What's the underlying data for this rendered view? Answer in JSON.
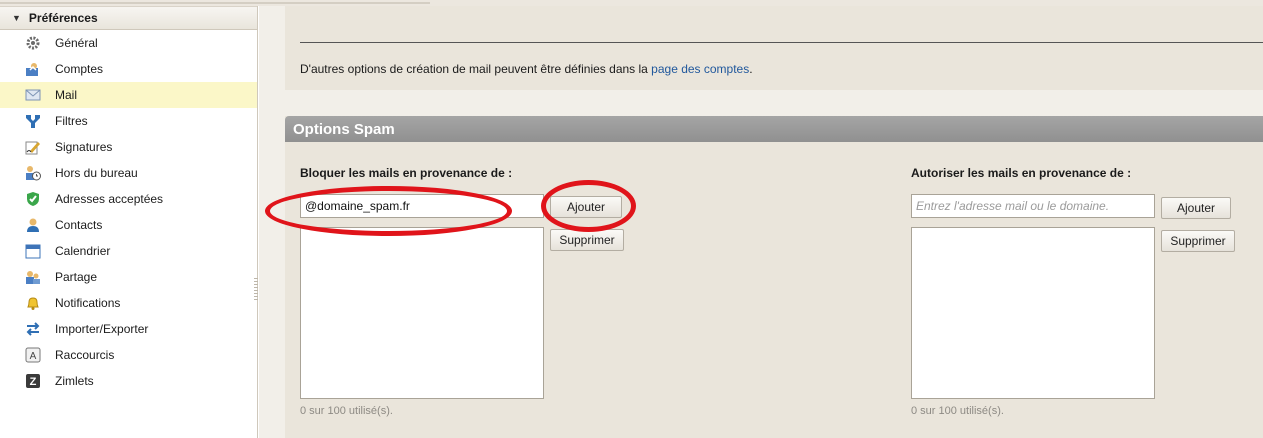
{
  "sidebar": {
    "header": "Préférences",
    "items": [
      {
        "label": "Général",
        "icon": "gear-icon",
        "selected": false
      },
      {
        "label": "Comptes",
        "icon": "accounts-icon",
        "selected": false
      },
      {
        "label": "Mail",
        "icon": "mail-icon",
        "selected": true
      },
      {
        "label": "Filtres",
        "icon": "filter-icon",
        "selected": false
      },
      {
        "label": "Signatures",
        "icon": "signature-icon",
        "selected": false
      },
      {
        "label": "Hors du bureau",
        "icon": "out-of-office-icon",
        "selected": false
      },
      {
        "label": "Adresses acceptées",
        "icon": "shield-check-icon",
        "selected": false
      },
      {
        "label": "Contacts",
        "icon": "contact-icon",
        "selected": false
      },
      {
        "label": "Calendrier",
        "icon": "calendar-icon",
        "selected": false
      },
      {
        "label": "Partage",
        "icon": "sharing-icon",
        "selected": false
      },
      {
        "label": "Notifications",
        "icon": "bell-icon",
        "selected": false
      },
      {
        "label": "Importer/Exporter",
        "icon": "import-export-icon",
        "selected": false
      },
      {
        "label": "Raccourcis",
        "icon": "shortcut-icon",
        "selected": false
      },
      {
        "label": "Zimlets",
        "icon": "zimlet-icon",
        "selected": false
      }
    ]
  },
  "main": {
    "info_text": "D'autres options de création de mail peuvent être définies dans la ",
    "info_link": "page des comptes",
    "info_suffix": ".",
    "spam": {
      "title": "Options Spam",
      "block": {
        "label": "Bloquer les mails en provenance de :",
        "input_value": "@domaine_spam.fr",
        "add_label": "Ajouter",
        "remove_label": "Supprimer",
        "usage": "0 sur 100 utilisé(s)."
      },
      "allow": {
        "label": "Autoriser les mails en provenance de :",
        "input_placeholder": "Entrez l'adresse mail ou le domaine.",
        "add_label": "Ajouter",
        "remove_label": "Supprimer",
        "usage": "0 sur 100 utilisé(s)."
      }
    }
  },
  "colors": {
    "annotation_ring": "#e0141a",
    "selected_item_bg": "#fbf7c8",
    "link": "#21589c",
    "spam_header": "#9a9a9a"
  }
}
